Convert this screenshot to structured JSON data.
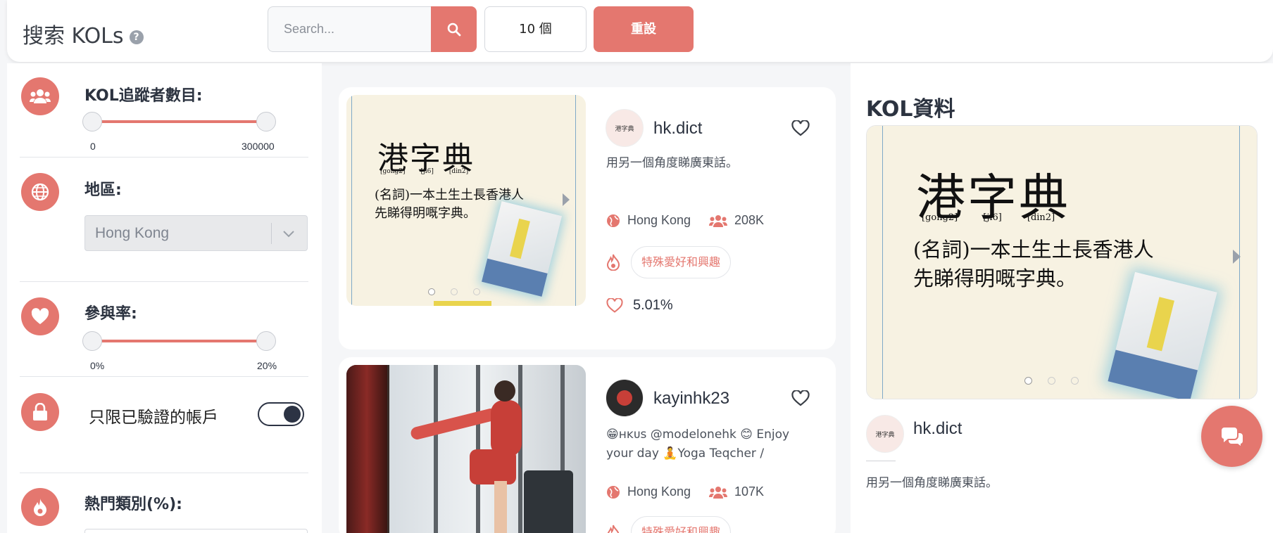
{
  "header": {
    "title": "搜索 KOLs",
    "help_icon": "question-circle-icon",
    "search_placeholder": "Search...",
    "search_icon": "search-icon",
    "count_label": "10 個",
    "reset_label": "重設"
  },
  "sidebar": {
    "followers": {
      "label": "KOL追蹤者數目:",
      "icon": "users-icon",
      "min": "0",
      "max": "300000"
    },
    "region": {
      "label": "地區:",
      "icon": "globe-icon",
      "selected": "Hong Kong"
    },
    "engagement": {
      "label": "參與率:",
      "icon": "heart-icon",
      "min": "0%",
      "max": "20%"
    },
    "verified": {
      "label": "只限已驗證的帳戶",
      "icon": "lock-icon",
      "enabled": true
    },
    "categories": {
      "label": "熱門類別(%):",
      "icon": "fire-icon"
    }
  },
  "cards": [
    {
      "name": "hk.dict",
      "avatar_text": "港字典",
      "bio": "用另一個角度睇廣東話。",
      "region": "Hong Kong",
      "followers": "208K",
      "tag": "特殊愛好和興趣",
      "engagement": "5.01%",
      "image": {
        "title": "港字典",
        "pron": [
          "[gong2]",
          "[ji6]",
          "[din2]"
        ],
        "line1": "(名詞)一本土生土長香港人",
        "line2": "先睇得明嘅字典。"
      }
    },
    {
      "name": "kayinhk23",
      "bio_line1": "😁ʜᴋᴜs @modelonehk 😊 Enjoy",
      "bio_line2": "your day 🧘Yoga Teqcher /",
      "region": "Hong Kong",
      "followers": "107K",
      "tag": "特殊愛好和興趣"
    }
  ],
  "panel": {
    "title": "KOL資料",
    "name": "hk.dict",
    "bio": "用另一個角度睇廣東話。"
  },
  "colors": {
    "accent": "#e4776f",
    "dark": "#2c3344"
  }
}
